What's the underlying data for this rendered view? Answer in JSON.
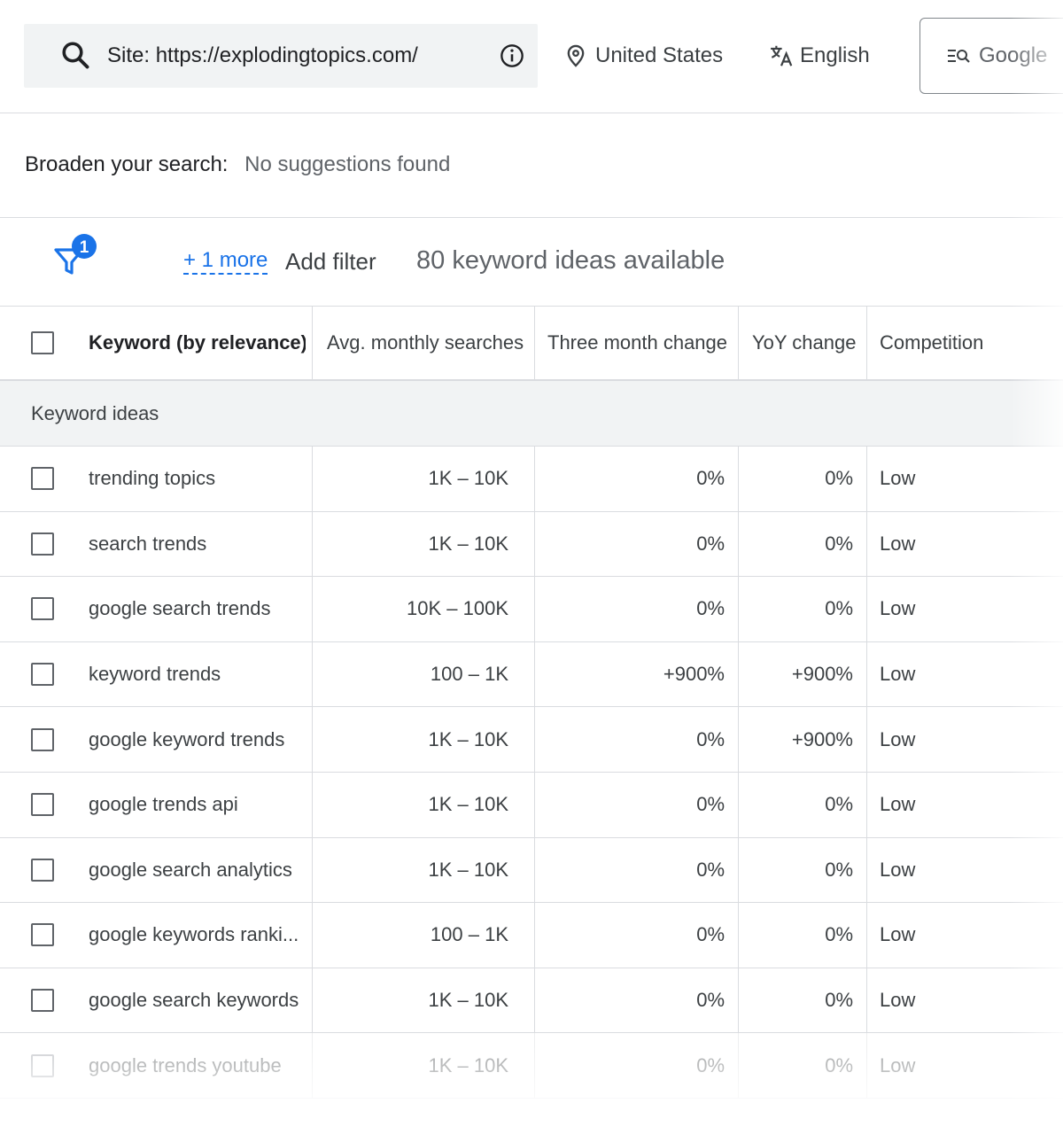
{
  "search": {
    "query": "Site: https://explodingtopics.com/"
  },
  "location": {
    "label": "United States"
  },
  "language": {
    "label": "English"
  },
  "network": {
    "label": "Google"
  },
  "broaden": {
    "label": "Broaden your search:",
    "value": "No suggestions found"
  },
  "filters": {
    "badge_count": "1",
    "more_link": "+ 1 more",
    "add_filter": "Add filter",
    "ideas_count": "80 keyword ideas available"
  },
  "table": {
    "headers": {
      "keyword": "Keyword (by relevance)",
      "avg": "Avg. monthly searches",
      "three_month": "Three month change",
      "yoy": "YoY change",
      "competition": "Competition"
    },
    "section_label": "Keyword ideas",
    "rows": [
      {
        "keyword": "trending topics",
        "avg": "1K – 10K",
        "three_month": "0%",
        "yoy": "0%",
        "competition": "Low"
      },
      {
        "keyword": "search trends",
        "avg": "1K – 10K",
        "three_month": "0%",
        "yoy": "0%",
        "competition": "Low"
      },
      {
        "keyword": "google search trends",
        "avg": "10K – 100K",
        "three_month": "0%",
        "yoy": "0%",
        "competition": "Low"
      },
      {
        "keyword": "keyword trends",
        "avg": "100 – 1K",
        "three_month": "+900%",
        "yoy": "+900%",
        "competition": "Low"
      },
      {
        "keyword": "google keyword trends",
        "avg": "1K – 10K",
        "three_month": "0%",
        "yoy": "+900%",
        "competition": "Low"
      },
      {
        "keyword": "google trends api",
        "avg": "1K – 10K",
        "three_month": "0%",
        "yoy": "0%",
        "competition": "Low"
      },
      {
        "keyword": "google search analytics",
        "avg": "1K – 10K",
        "three_month": "0%",
        "yoy": "0%",
        "competition": "Low"
      },
      {
        "keyword": "google keywords ranki...",
        "avg": "100 – 1K",
        "three_month": "0%",
        "yoy": "0%",
        "competition": "Low"
      },
      {
        "keyword": "google search keywords",
        "avg": "1K – 10K",
        "three_month": "0%",
        "yoy": "0%",
        "competition": "Low"
      },
      {
        "keyword": "google trends youtube",
        "avg": "1K – 10K",
        "three_month": "0%",
        "yoy": "0%",
        "competition": "Low"
      }
    ]
  },
  "colors": {
    "accent": "#1a73e8",
    "badge": "#1a73e8",
    "text": "#3c4043",
    "divider": "#dadce0",
    "search_bg": "#f1f3f4"
  }
}
